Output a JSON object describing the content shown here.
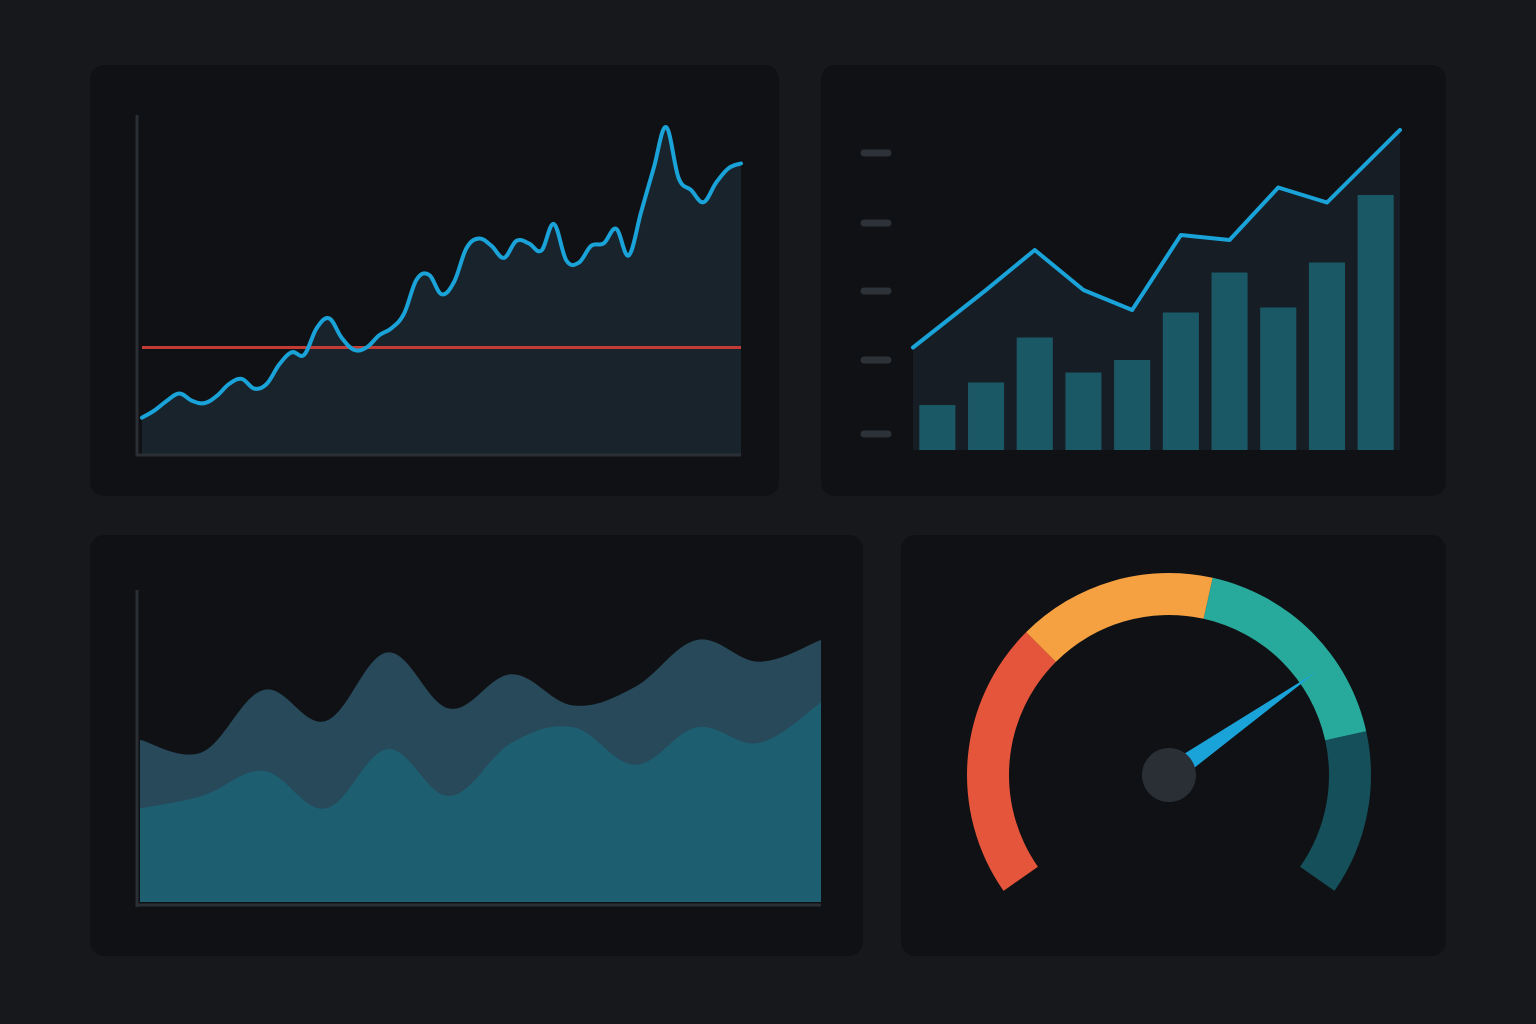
{
  "colors": {
    "background": "#17181b",
    "panel": "#0f1114",
    "axis": "#2a2f36",
    "line": "#1aa3d9",
    "line_fill": "#1a2730",
    "threshold": "#c23b35",
    "bar": "#1b5866",
    "tick": "#2d3238",
    "area_back": "#27495a",
    "area_front": "#1d5e70",
    "gauge_red": "#e4553c",
    "gauge_orange": "#f5a142",
    "gauge_teal": "#27a99b",
    "gauge_dark_teal": "#154f59",
    "gauge_needle": "#1aa3d9",
    "gauge_hub": "#2a2f36"
  },
  "chart_data": [
    {
      "type": "line",
      "x": [
        0,
        1,
        2,
        3,
        4,
        5,
        6,
        7,
        8,
        9,
        10,
        11,
        12,
        13,
        14,
        15,
        16,
        17,
        18,
        19,
        20,
        21,
        22,
        23,
        24,
        25,
        26,
        27,
        28,
        29,
        30,
        31,
        32,
        33,
        34,
        35,
        36,
        37,
        38,
        39,
        40,
        41,
        42,
        43,
        44,
        45,
        46,
        47,
        48
      ],
      "series": [
        {
          "values": [
            15,
            18,
            22,
            25,
            22,
            21,
            24,
            29,
            31,
            27,
            29,
            37,
            42,
            41,
            52,
            56,
            48,
            43,
            44,
            49,
            52,
            58,
            72,
            74,
            66,
            71,
            85,
            89,
            86,
            81,
            88,
            87,
            84,
            95,
            80,
            79,
            86,
            87,
            93,
            82,
            100,
            118,
            135,
            114,
            109,
            104,
            112,
            118,
            120
          ]
        }
      ],
      "threshold": 44,
      "ylim": [
        0,
        140
      ],
      "xlim": [
        0,
        48
      ]
    },
    {
      "type": "bar",
      "categories": [
        "1",
        "2",
        "3",
        "4",
        "5",
        "6",
        "7",
        "8",
        "9",
        "10"
      ],
      "values": [
        18,
        27,
        45,
        31,
        36,
        55,
        71,
        57,
        75,
        102
      ],
      "line": [
        41,
        64,
        80,
        64,
        56,
        86,
        84,
        105,
        99,
        128
      ],
      "ylim": [
        0,
        140
      ]
    },
    {
      "type": "area",
      "x": [
        0,
        1,
        2,
        3,
        4,
        5,
        6,
        7,
        8,
        9,
        10,
        11,
        12
      ],
      "series": [
        {
          "values": [
            52,
            48,
            68,
            58,
            80,
            62,
            73,
            63,
            69,
            84,
            77,
            84
          ]
        },
        {
          "values": [
            30,
            34,
            42,
            30,
            49,
            34,
            51,
            56,
            44,
            56,
            51,
            64
          ]
        }
      ],
      "ylim": [
        0,
        100
      ]
    },
    {
      "type": "gauge",
      "segments": [
        {
          "color": "#e4553c",
          "from": 0,
          "to": 0.32
        },
        {
          "color": "#f5a142",
          "from": 0.32,
          "to": 0.55
        },
        {
          "color": "#27a99b",
          "from": 0.55,
          "to": 0.81
        },
        {
          "color": "#154f59",
          "from": 0.81,
          "to": 1
        }
      ],
      "value": 0.72
    }
  ]
}
